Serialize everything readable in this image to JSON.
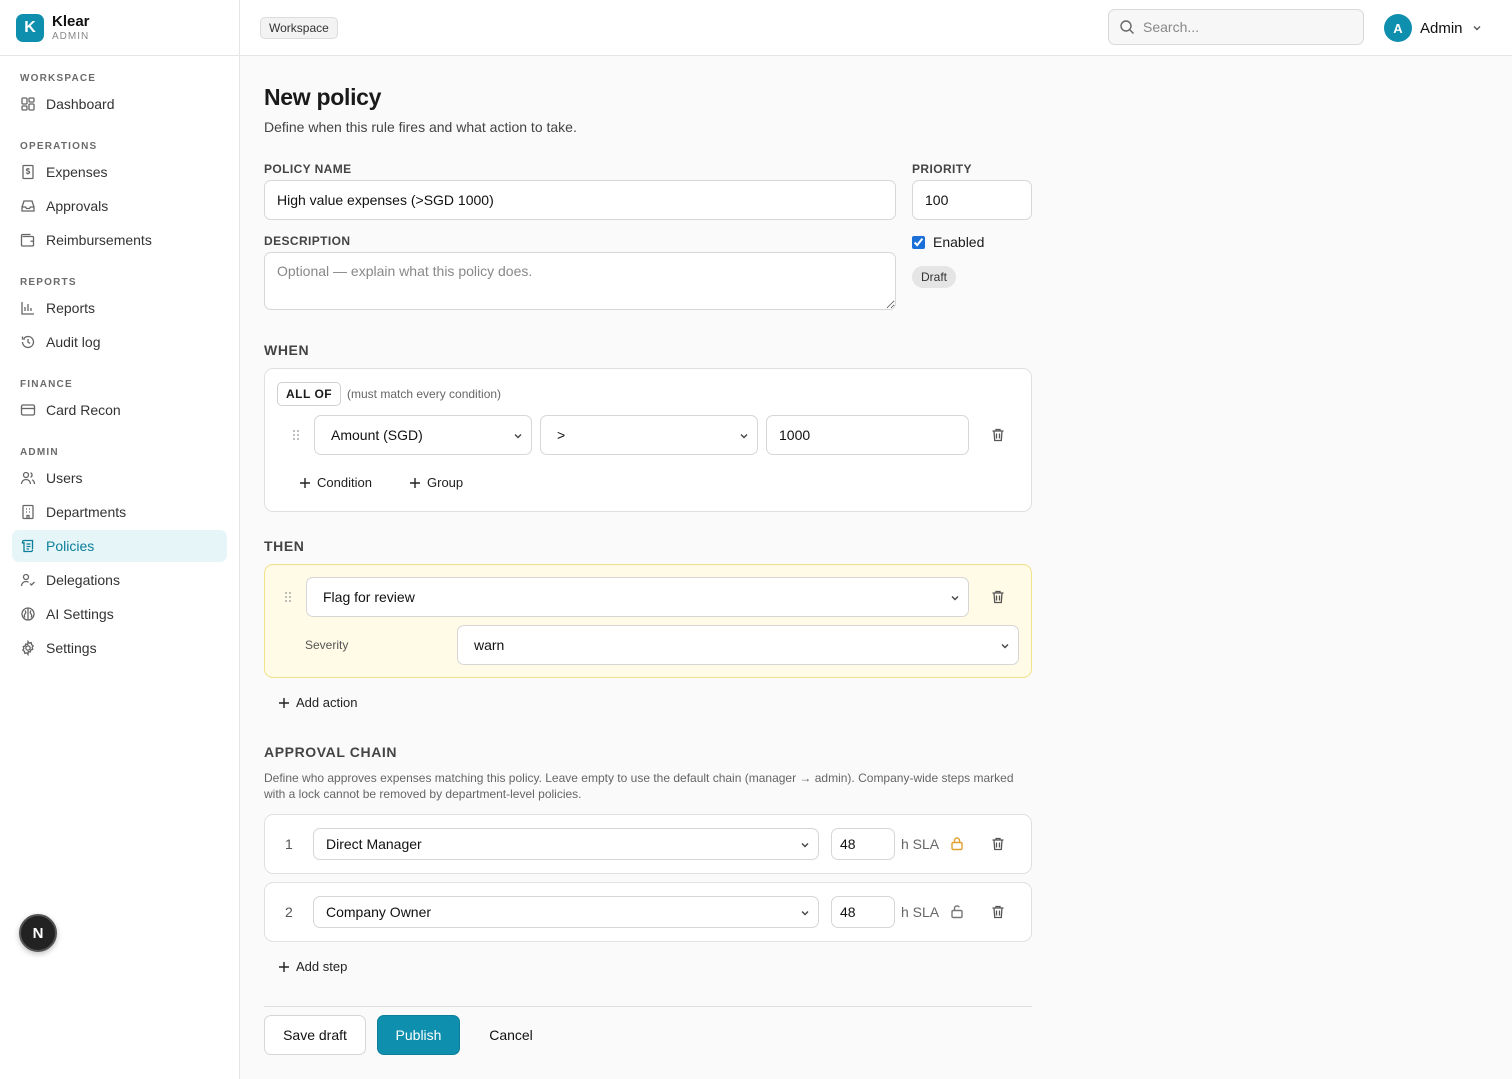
{
  "brand": {
    "logo_letter": "K",
    "name": "Klear",
    "subtitle": "ADMIN"
  },
  "sidebar": {
    "sections": [
      {
        "title": "WORKSPACE",
        "items": [
          {
            "label": "Dashboard",
            "icon": "dashboard-icon"
          }
        ]
      },
      {
        "title": "OPERATIONS",
        "items": [
          {
            "label": "Expenses",
            "icon": "receipt-icon"
          },
          {
            "label": "Approvals",
            "icon": "inbox-icon"
          },
          {
            "label": "Reimbursements",
            "icon": "wallet-icon"
          }
        ]
      },
      {
        "title": "REPORTS",
        "items": [
          {
            "label": "Reports",
            "icon": "bar-chart-icon"
          },
          {
            "label": "Audit log",
            "icon": "history-icon"
          }
        ]
      },
      {
        "title": "FINANCE",
        "items": [
          {
            "label": "Card Recon",
            "icon": "credit-card-icon"
          }
        ]
      },
      {
        "title": "ADMIN",
        "items": [
          {
            "label": "Users",
            "icon": "users-icon"
          },
          {
            "label": "Departments",
            "icon": "building-icon"
          },
          {
            "label": "Policies",
            "icon": "scroll-icon",
            "active": true
          },
          {
            "label": "Delegations",
            "icon": "user-check-icon"
          },
          {
            "label": "AI Settings",
            "icon": "brain-icon"
          },
          {
            "label": "Settings",
            "icon": "gear-icon"
          }
        ]
      }
    ],
    "fab_letter": "N"
  },
  "topbar": {
    "breadcrumb": "Workspace",
    "search_placeholder": "Search...",
    "user_initial": "A",
    "user_name": "Admin"
  },
  "page": {
    "title": "New policy",
    "subtitle": "Define when this rule fires and what action to take."
  },
  "form": {
    "policy_name_label": "POLICY NAME",
    "policy_name_value": "High value expenses (>SGD 1000)",
    "priority_label": "PRIORITY",
    "priority_value": "100",
    "description_label": "DESCRIPTION",
    "description_placeholder": "Optional — explain what this policy does.",
    "enabled_label": "Enabled",
    "status_badge": "Draft"
  },
  "when": {
    "title": "WHEN",
    "match_mode": "ALL OF",
    "match_hint": "(must match every condition)",
    "condition": {
      "field": "Amount (SGD)",
      "operator": ">",
      "value": "1000"
    },
    "add_condition_label": "Condition",
    "add_group_label": "Group"
  },
  "then": {
    "title": "THEN",
    "action": "Flag for review",
    "severity_label": "Severity",
    "severity_value": "warn",
    "add_action_label": "Add action"
  },
  "approval": {
    "title": "APPROVAL CHAIN",
    "description": "Define who approves expenses matching this policy. Leave empty to use the default chain (manager → admin). Company-wide steps marked with a lock cannot be removed by department-level policies.",
    "steps": [
      {
        "num": "1",
        "approver": "Direct Manager",
        "sla": "48",
        "sla_unit": "h SLA",
        "locked": true
      },
      {
        "num": "2",
        "approver": "Company Owner",
        "sla": "48",
        "sla_unit": "h SLA",
        "locked": false
      }
    ],
    "add_step_label": "Add step"
  },
  "footer": {
    "save_draft": "Save draft",
    "publish": "Publish",
    "cancel": "Cancel"
  },
  "colors": {
    "accent": "#0e8fad",
    "active_nav_bg": "#e6f5f8",
    "then_card_bg": "#fffbe6",
    "lock_locked": "#e0a030"
  }
}
